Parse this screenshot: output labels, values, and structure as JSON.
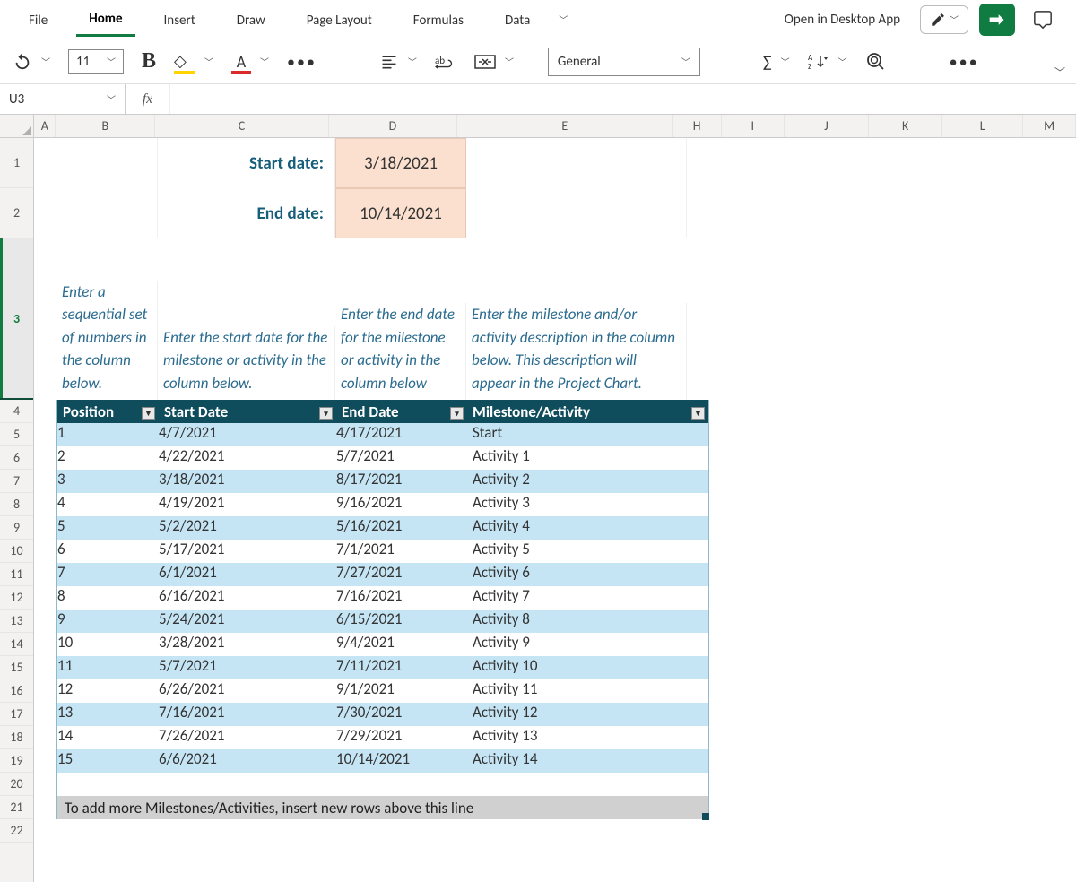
{
  "ribbon": {
    "tabs": [
      "File",
      "Home",
      "Insert",
      "Draw",
      "Page Layout",
      "Formulas",
      "Data"
    ],
    "active": "Home",
    "open_desktop": "Open in Desktop App"
  },
  "toolbar": {
    "font_size": "11",
    "number_format": "General"
  },
  "fx": {
    "namebox": "U3",
    "formula": ""
  },
  "columns": [
    "A",
    "B",
    "C",
    "D",
    "E",
    "H",
    "I",
    "J",
    "K",
    "L",
    "M"
  ],
  "row_numbers": [
    "1",
    "2",
    "3",
    "4",
    "5",
    "6",
    "7",
    "8",
    "9",
    "10",
    "11",
    "12",
    "13",
    "14",
    "15",
    "16",
    "17",
    "18",
    "19",
    "20",
    "21",
    "22"
  ],
  "dates": {
    "start_label": "Start date:",
    "start_value": "3/18/2021",
    "end_label": "End date:",
    "end_value": "10/14/2021"
  },
  "instructions": {
    "position": "Enter a sequential set of numbers in the column below.",
    "start": "Enter the start date for the milestone or activity in the column below.",
    "end": "Enter the end date for the milestone or activity in the column below",
    "milestone": "Enter the milestone and/or activity description in the column below. This description will appear in the Project Chart."
  },
  "table": {
    "headers": [
      "Position",
      "Start Date",
      "End Date",
      "Milestone/Activity"
    ],
    "rows": [
      {
        "pos": "1",
        "start": "4/7/2021",
        "end": "4/17/2021",
        "act": "Start"
      },
      {
        "pos": "2",
        "start": "4/22/2021",
        "end": "5/7/2021",
        "act": "Activity 1"
      },
      {
        "pos": "3",
        "start": "3/18/2021",
        "end": "8/17/2021",
        "act": "Activity 2"
      },
      {
        "pos": "4",
        "start": "4/19/2021",
        "end": "9/16/2021",
        "act": "Activity 3"
      },
      {
        "pos": "5",
        "start": "5/2/2021",
        "end": "5/16/2021",
        "act": "Activity 4"
      },
      {
        "pos": "6",
        "start": "5/17/2021",
        "end": "7/1/2021",
        "act": "Activity 5"
      },
      {
        "pos": "7",
        "start": "6/1/2021",
        "end": "7/27/2021",
        "act": "Activity 6"
      },
      {
        "pos": "8",
        "start": "6/16/2021",
        "end": "7/16/2021",
        "act": "Activity 7"
      },
      {
        "pos": "9",
        "start": "5/24/2021",
        "end": "6/15/2021",
        "act": "Activity 8"
      },
      {
        "pos": "10",
        "start": "3/28/2021",
        "end": "9/4/2021",
        "act": "Activity 9"
      },
      {
        "pos": "11",
        "start": "5/7/2021",
        "end": "7/11/2021",
        "act": "Activity 10"
      },
      {
        "pos": "12",
        "start": "6/26/2021",
        "end": "9/1/2021",
        "act": "Activity 11"
      },
      {
        "pos": "13",
        "start": "7/16/2021",
        "end": "7/30/2021",
        "act": "Activity 12"
      },
      {
        "pos": "14",
        "start": "7/26/2021",
        "end": "7/29/2021",
        "act": "Activity 13"
      },
      {
        "pos": "15",
        "start": "6/6/2021",
        "end": "10/14/2021",
        "act": "Activity 14"
      }
    ],
    "footer": "To add more Milestones/Activities, insert new rows above this line"
  }
}
